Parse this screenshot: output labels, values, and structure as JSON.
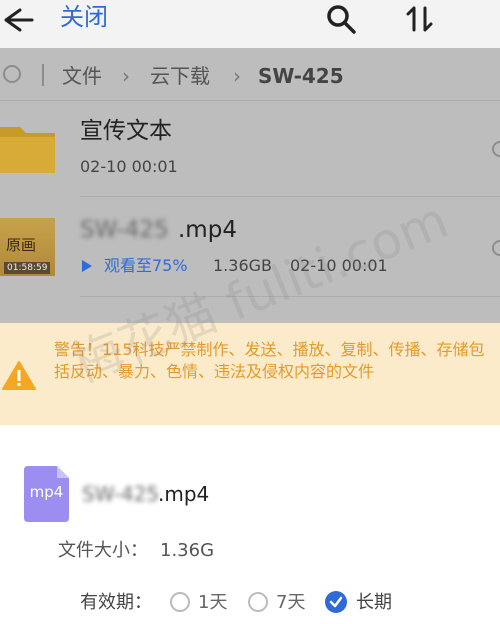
{
  "topbar": {
    "close_label": "关闭",
    "icons": [
      "back-arrow-icon",
      "search-icon",
      "sort-icon"
    ]
  },
  "breadcrumb": [
    "文件",
    "云下载",
    "SW-425"
  ],
  "list": {
    "folder": {
      "name": "宣传文本",
      "date": "02-10 00:01"
    },
    "video": {
      "name_blurred": "SW-425",
      "name_suffix": ".mp4",
      "thumb_label": "原画",
      "thumb_time": "01:58:59",
      "watched": "观看至75%",
      "size": "1.36GB",
      "date": "02-10 00:01"
    }
  },
  "warning": {
    "text": "警告！115科技严禁制作、发送、播放、复制、传播、存储包括反动、暴力、色情、违法及侵权内容的文件",
    "color": "#e39a2c"
  },
  "sheet": {
    "file_ext": "mp4",
    "name_blurred": "SW-425",
    "name_suffix": ".mp4",
    "size_label": "文件大小：",
    "size_value": "1.36G",
    "validity_label": "有效期：",
    "options": [
      "1天",
      "7天",
      "长期"
    ],
    "selected": "长期"
  },
  "watermark": "梅花猫 fuliti.com",
  "accent": "#2f6bd7"
}
